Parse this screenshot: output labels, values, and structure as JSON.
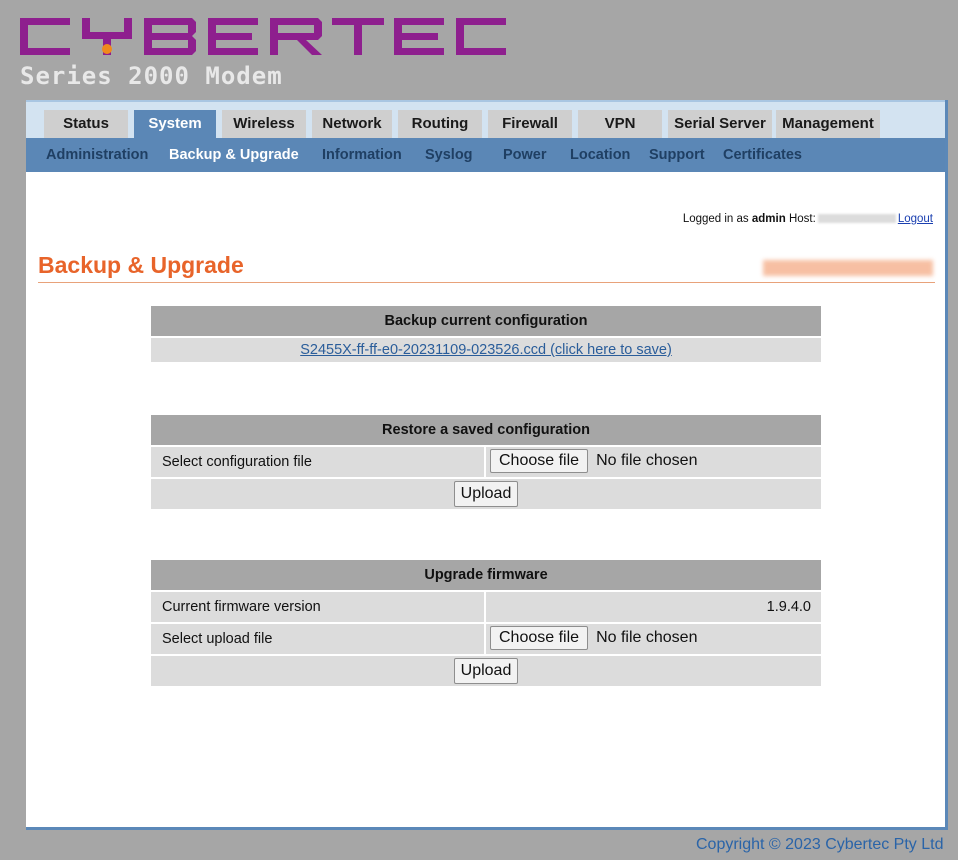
{
  "brand": {
    "logo_text": "CYBERTEC",
    "subtitle": "Series 2000 Modem",
    "logo_color": "#8e1f8e",
    "dot_color": "#f08a1c"
  },
  "tabs": [
    {
      "label": "Status",
      "active": false
    },
    {
      "label": "System",
      "active": true
    },
    {
      "label": "Wireless",
      "active": false
    },
    {
      "label": "Network",
      "active": false
    },
    {
      "label": "Routing",
      "active": false
    },
    {
      "label": "Firewall",
      "active": false
    },
    {
      "label": "VPN",
      "active": false
    },
    {
      "label": "Serial Server",
      "active": false
    },
    {
      "label": "Management",
      "active": false
    }
  ],
  "subnav": [
    {
      "label": "Administration",
      "active": false
    },
    {
      "label": "Backup & Upgrade",
      "active": true
    },
    {
      "label": "Information",
      "active": false
    },
    {
      "label": "Syslog",
      "active": false
    },
    {
      "label": "Power",
      "active": false
    },
    {
      "label": "Location",
      "active": false
    },
    {
      "label": "Support",
      "active": false
    },
    {
      "label": "Certificates",
      "active": false
    }
  ],
  "session": {
    "logged_in_prefix": "Logged in as",
    "user": "admin",
    "host_label": "Host:",
    "logout": "Logout"
  },
  "page": {
    "title": "Backup & Upgrade",
    "title_color": "#e8642a"
  },
  "backup": {
    "heading": "Backup current configuration",
    "link": "S2455X-ff-ff-e0-20231109-023526.ccd (click here to save)"
  },
  "restore": {
    "heading": "Restore a saved configuration",
    "select_label": "Select configuration file",
    "choose_button": "Choose file",
    "no_file": "No file chosen",
    "upload_button": "Upload"
  },
  "firmware": {
    "heading": "Upgrade firmware",
    "current_label": "Current firmware version",
    "current_value": "1.9.4.0",
    "select_label": "Select upload file",
    "choose_button": "Choose file",
    "no_file": "No file chosen",
    "upload_button": "Upload"
  },
  "footer": {
    "copyright": "Copyright © 2023 Cybertec Pty Ltd"
  }
}
